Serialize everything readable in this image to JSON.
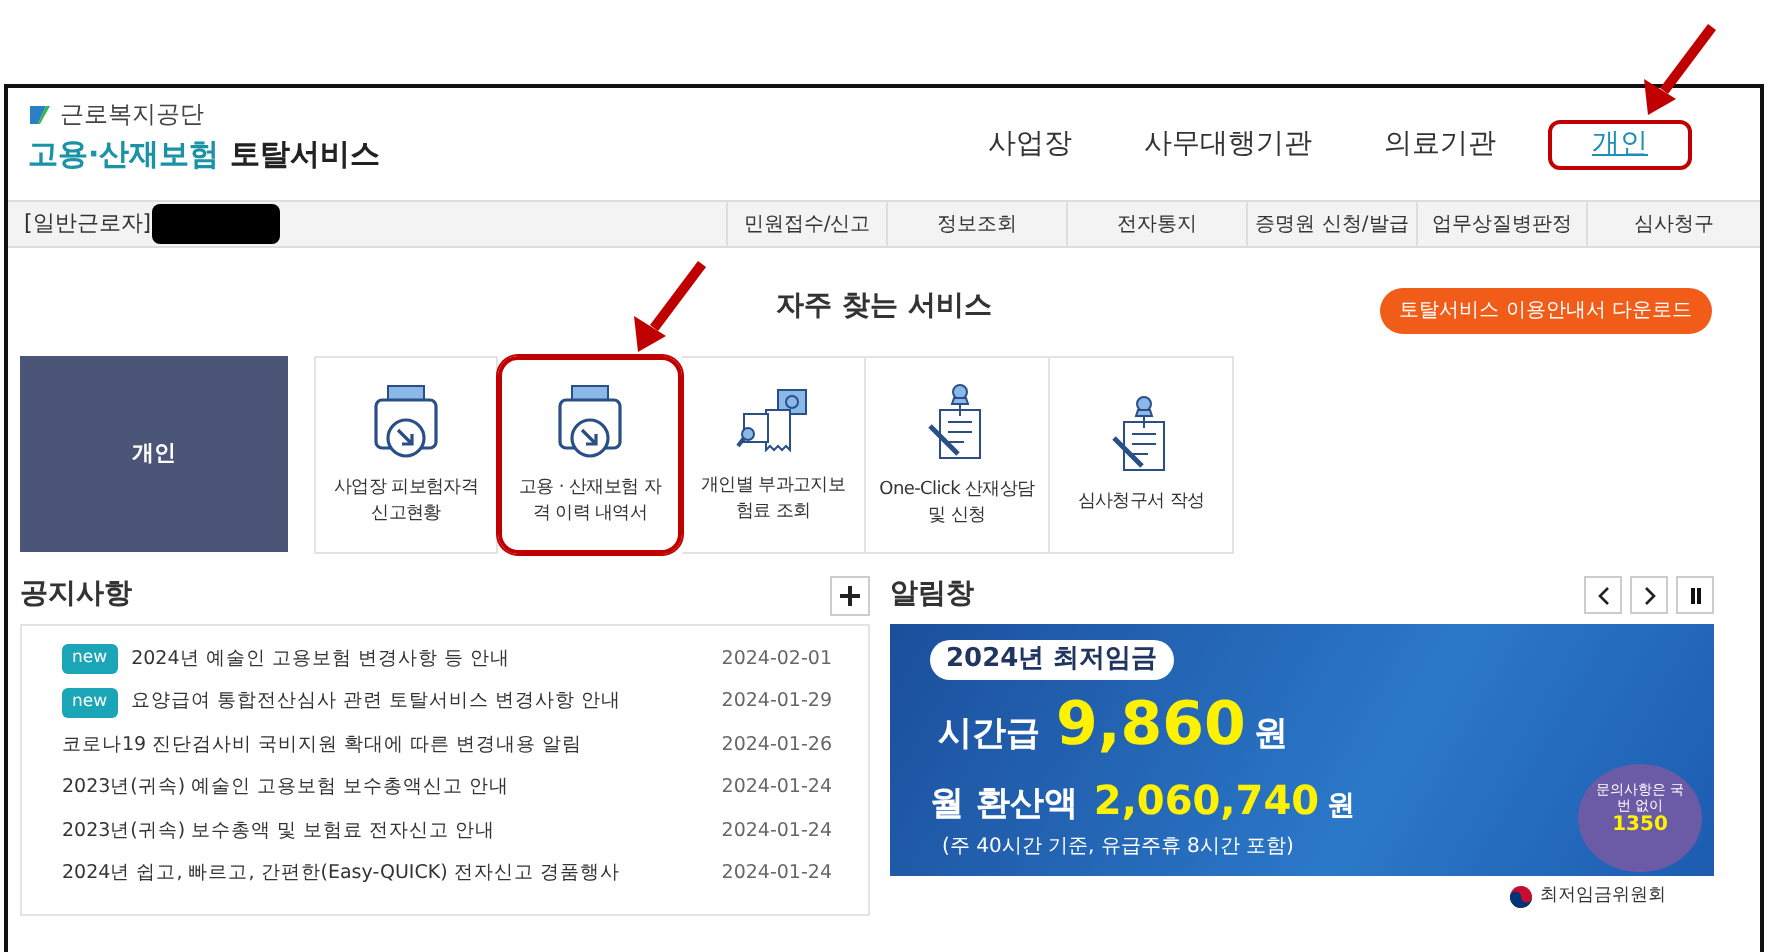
{
  "header": {
    "org": "근로복지공단",
    "service_highlight": "고용·산재보험",
    "service_rest": "토탈서비스"
  },
  "top_nav": [
    {
      "label": "사업장",
      "selected": false,
      "highlighted": false
    },
    {
      "label": "사무대행기관",
      "selected": false,
      "highlighted": false
    },
    {
      "label": "의료기관",
      "selected": false,
      "highlighted": false
    },
    {
      "label": "개인",
      "selected": true,
      "highlighted": true
    }
  ],
  "user_bar": {
    "label": "[일반근로자]",
    "name_redacted": true
  },
  "menu": [
    "민원접수/신고",
    "정보조회",
    "전자통지",
    "증명원 신청/발급",
    "업무상질병판정",
    "심사청구"
  ],
  "favorites": {
    "title": "자주 찾는 서비스",
    "guide_button": "토탈서비스 이용안내서 다운로드",
    "category": "개인",
    "tiles": [
      {
        "kind": "tray",
        "lines": [
          "사업장 피보험자격",
          "신고현황"
        ],
        "highlighted": false
      },
      {
        "kind": "tray",
        "lines": [
          "고용 · 산재보험 자",
          "격 이력 내역서"
        ],
        "highlighted": true
      },
      {
        "kind": "search",
        "lines": [
          "개인별 부과고지보",
          "험료 조회"
        ],
        "highlighted": false
      },
      {
        "kind": "pin",
        "lines": [
          "One-Click 산재상담",
          "및 신청"
        ],
        "highlighted": false
      },
      {
        "kind": "pin",
        "lines": [
          "심사청구서 작성"
        ],
        "highlighted": false
      }
    ]
  },
  "notices": {
    "title": "공지사항",
    "items": [
      {
        "new": true,
        "label": "new",
        "title": "2024년 예술인 고용보험 변경사항 등 안내",
        "date": "2024-02-01"
      },
      {
        "new": true,
        "label": "new",
        "title": "요양급여 통합전산심사 관련 토탈서비스 변경사항 안내",
        "date": "2024-01-29"
      },
      {
        "new": false,
        "title": "코로나19 진단검사비 국비지원 확대에 따른 변경내용 알림",
        "date": "2024-01-26"
      },
      {
        "new": false,
        "title": "2023년(귀속) 예술인 고용보험 보수총액신고 안내",
        "date": "2024-01-24"
      },
      {
        "new": false,
        "title": "2023년(귀속) 보수총액 및 보험료 전자신고 안내",
        "date": "2024-01-24"
      },
      {
        "new": false,
        "title": "2024년 쉽고, 빠르고, 간편한(Easy-QUICK) 전자신고 경품행사",
        "date": "2024-01-24"
      }
    ]
  },
  "alerts": {
    "title": "알림창",
    "banner": {
      "badge": "2024년 최저임금",
      "hourly_label": "시간급",
      "hourly_amount": "9,860",
      "hourly_unit": "원",
      "monthly_label": "월 환산액",
      "monthly_amount": "2,060,740",
      "monthly_unit": "원",
      "note": "(주 40시간 기준, 유급주휴 8시간 포함)",
      "bubble_text": "문의사항은 국번 없이",
      "bubble_number": "1350",
      "footer": "최저임금위원회"
    }
  }
}
